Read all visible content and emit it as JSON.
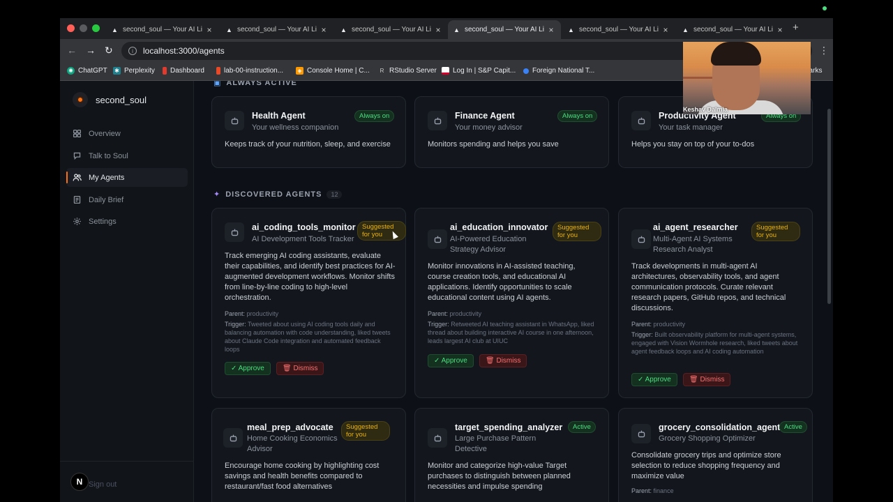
{
  "browser": {
    "tabs": [
      {
        "label": "second_soul — Your AI Li",
        "active": false
      },
      {
        "label": "second_soul — Your AI Li",
        "active": false
      },
      {
        "label": "second_soul — Your AI Li",
        "active": false
      },
      {
        "label": "second_soul — Your AI Li",
        "active": true
      },
      {
        "label": "second_soul — Your AI Li",
        "active": false
      },
      {
        "label": "second_soul — Your AI Li",
        "active": false
      }
    ],
    "url": "localhost:3000/agents",
    "bookmarks": [
      {
        "label": "ChatGPT",
        "icon": "chatgpt-icon",
        "color": "#10a37f"
      },
      {
        "label": "Perplexity",
        "icon": "perplexity-icon",
        "color": "#20808d"
      },
      {
        "label": "Dashboard",
        "icon": "dashboard-icon",
        "color": "#e23b2e"
      },
      {
        "label": "lab-00-instruction...",
        "icon": "illinois-icon",
        "color": "#e84a27"
      },
      {
        "label": "Console Home | C...",
        "icon": "aws-icon",
        "color": "#ff9900"
      },
      {
        "label": "RStudio Server",
        "icon": "r-icon",
        "color": "#555555"
      },
      {
        "label": "Log In | S&P Capit...",
        "icon": "sp-icon",
        "color": "#d6002a"
      },
      {
        "label": "Foreign National T...",
        "icon": "globe-icon",
        "color": "#3b82f6"
      }
    ],
    "bookmarks_overflow": "narks"
  },
  "sidebar": {
    "brand": "second_soul",
    "items": [
      {
        "label": "Overview",
        "icon": "grid-icon",
        "active": false
      },
      {
        "label": "Talk to Soul",
        "icon": "chat-icon",
        "active": false
      },
      {
        "label": "My Agents",
        "icon": "users-icon",
        "active": true
      },
      {
        "label": "Daily Brief",
        "icon": "document-icon",
        "active": false
      },
      {
        "label": "Settings",
        "icon": "gear-icon",
        "active": false
      }
    ],
    "sign_out": "Sign out",
    "avatar_letter": "N"
  },
  "always_active": {
    "heading": "ALWAYS ACTIVE",
    "agents": [
      {
        "title": "Health Agent",
        "subtitle": "Your wellness companion",
        "badge": "Always on",
        "description": "Keeps track of your nutrition, sleep, and exercise"
      },
      {
        "title": "Finance Agent",
        "subtitle": "Your money advisor",
        "badge": "Always on",
        "description": "Monitors spending and helps you save"
      },
      {
        "title": "Productivity Agent",
        "subtitle": "Your task manager",
        "badge": "Always on",
        "description": "Helps you stay on top of your to-dos"
      }
    ]
  },
  "discovered": {
    "heading": "DISCOVERED AGENTS",
    "count": "12",
    "agents": [
      {
        "title": "ai_coding_tools_monitor",
        "subtitle": "AI Development Tools Tracker",
        "badge": "Suggested for you",
        "description": "Track emerging AI coding assistants, evaluate their capabilities, and identify best practices for AI-augmented development workflows. Monitor shifts from line-by-line coding to high-level orchestration.",
        "parent_label": "Parent:",
        "parent": "productivity",
        "trigger_label": "Trigger:",
        "trigger": "Tweeted about using AI coding tools daily and balancing automation with code understanding, liked tweets about Claude Code integration and automated feedback loops",
        "approve": "Approve",
        "dismiss": "Dismiss"
      },
      {
        "title": "ai_education_innovator",
        "subtitle": "AI-Powered Education Strategy Advisor",
        "badge": "Suggested for you",
        "description": "Monitor innovations in AI-assisted teaching, course creation tools, and educational AI applications. Identify opportunities to scale educational content using AI agents.",
        "parent_label": "Parent:",
        "parent": "productivity",
        "trigger_label": "Trigger:",
        "trigger": "Retweeted AI teaching assistant in WhatsApp, liked thread about building interactive AI course in one afternoon, leads largest AI club at UIUC",
        "approve": "Approve",
        "dismiss": "Dismiss"
      },
      {
        "title": "ai_agent_researcher",
        "subtitle": "Multi-Agent AI Systems Research Analyst",
        "badge": "Suggested for you",
        "description": "Track developments in multi-agent AI architectures, observability tools, and agent communication protocols. Curate relevant research papers, GitHub repos, and technical discussions.",
        "parent_label": "Parent:",
        "parent": "productivity",
        "trigger_label": "Trigger:",
        "trigger": "Built observability platform for multi-agent systems, engaged with Vision Wormhole research, liked tweets about agent feedback loops and AI coding automation",
        "approve": "Approve",
        "dismiss": "Dismiss"
      },
      {
        "title": "meal_prep_advocate",
        "subtitle": "Home Cooking Economics Advisor",
        "badge": "Suggested for you",
        "description": "Encourage home cooking by highlighting cost savings and health benefits compared to restaurant/fast food alternatives"
      },
      {
        "title": "target_spending_analyzer",
        "subtitle": "Large Purchase Pattern Detective",
        "badge": "Active",
        "description": "Monitor and categorize high-value Target purchases to distinguish between planned necessities and impulse spending"
      },
      {
        "title": "grocery_consolidation_agent",
        "subtitle": "Grocery Shopping Optimizer",
        "badge": "Active",
        "description": "Consolidate grocery trips and optimize store selection to reduce shopping frequency and maximize value",
        "parent_label": "Parent:",
        "parent": "finance"
      }
    ]
  },
  "webcam": {
    "name": "Keshav Dalmia"
  },
  "colors": {
    "accent": "#f97316",
    "active_green": "#4ade80",
    "suggested_yellow": "#eab308",
    "dismiss_red": "#f87171"
  }
}
